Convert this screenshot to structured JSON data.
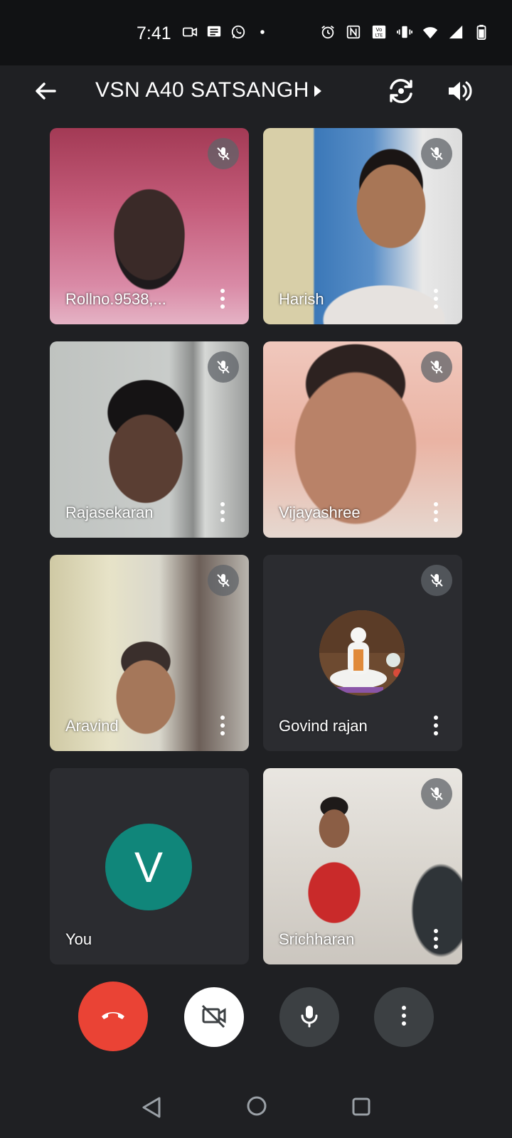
{
  "status_bar": {
    "time": "7:41",
    "left_icons": [
      "video-call-icon",
      "message-icon",
      "whatsapp-icon",
      "dot-icon"
    ],
    "right_icons": [
      "alarm-icon",
      "nfc-icon",
      "volte-icon",
      "vibrate-icon",
      "wifi-icon",
      "signal-icon",
      "battery-icon"
    ]
  },
  "header": {
    "back_icon": "arrow-back-icon",
    "title": "VSN A40 SATSANGH",
    "caret_icon": "caret-right-icon",
    "switch_camera_icon": "switch-camera-icon",
    "speaker_icon": "speaker-icon"
  },
  "participants": [
    {
      "name": "Rollno.9538,...",
      "muted": true,
      "type": "video"
    },
    {
      "name": "Harish",
      "muted": true,
      "type": "video"
    },
    {
      "name": "Rajasekaran",
      "muted": true,
      "type": "video"
    },
    {
      "name": "Vijayashree",
      "muted": true,
      "type": "video"
    },
    {
      "name": "Aravind",
      "muted": true,
      "type": "video"
    },
    {
      "name": "Govind rajan",
      "muted": true,
      "type": "avatar-photo"
    },
    {
      "name": "You",
      "muted": false,
      "type": "avatar-initial",
      "initial": "V",
      "avatar_color": "#10867a"
    },
    {
      "name": "Srichharan",
      "muted": true,
      "type": "video"
    }
  ],
  "controls": {
    "end_call_icon": "end-call-icon",
    "end_call_color": "#ea4335",
    "video_off_icon": "video-off-icon",
    "mic_icon": "mic-icon",
    "more_icon": "more-vert-icon"
  },
  "nav_bar": {
    "back_icon": "nav-back-icon",
    "home_icon": "nav-home-icon",
    "recents_icon": "nav-recents-icon"
  }
}
